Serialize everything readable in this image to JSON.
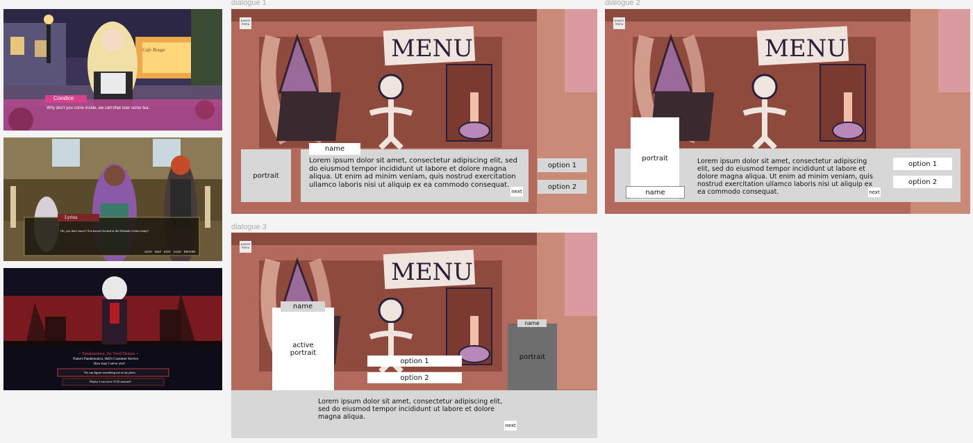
{
  "colors": {
    "canvas": "#f4f4f4",
    "scene_bg": "#b36a5c",
    "panel": "#d7d7d7",
    "dark_portrait": "#6e6e6e",
    "label": "#a9a9a9"
  },
  "references": {
    "ref1": {
      "speaker": "Condice",
      "line": "Why don't you come inside, we can chat over some tea.",
      "sign": "Cafe Rouge"
    },
    "ref2": {
      "speaker": "Lyrina",
      "line": "Oh, you don't know? You haven't looked at the Nalendir Codex today?",
      "menu": [
        "AUTO",
        "SKIP",
        "SAVE",
        "LOAD",
        "HISTORY"
      ]
    },
    "ref3": {
      "title": "⋆ Pandemonica, the Tired Demon ⋆",
      "line1": "Name's Pandemonica, Hell's Customer Service.",
      "line2": "How may I serve you?",
      "choice1": "We can figure something out at my place.",
      "choice2": "Maybe I can serve YOU instead?"
    }
  },
  "frames": {
    "d1": {
      "label": "dialogue 1",
      "pause": [
        "pause/",
        "menu"
      ],
      "sign": "MENU",
      "portrait": "portrait",
      "name": "name",
      "body": "Lorem ipsum dolor sit amet, consectetur adipiscing elit, sed do eiusmod tempor incididunt ut labore et dolore magna aliqua. Ut enim ad minim veniam, quis nostrud exercitation ullamco laboris nisi ut aliquip ex ea commodo consequat.",
      "next": "next",
      "option1": "option 1",
      "option2": "option 2"
    },
    "d2": {
      "label": "dialogue 2",
      "pause": [
        "pause/",
        "menu"
      ],
      "sign": "MENU",
      "portrait": "portrait",
      "name": "name",
      "body": "Lorem ipsum dolor sit amet, consectetur adipiscing elit, sed do eiusmod tempor incididunt ut labore et dolore magna aliqua. Ut enim ad minim veniam, quis nostrud exercitation ullamco laboris nisi ut aliquip ex ea commodo consequat.",
      "next": "next",
      "option1": "option 1",
      "option2": "option 2"
    },
    "d3": {
      "label": "dialogue 3",
      "pause": [
        "pause/",
        "menu"
      ],
      "sign": "MENU",
      "active_portrait": "active portrait",
      "active_name": "name",
      "portrait": "portrait",
      "name": "name",
      "body": "Lorem ipsum dolor sit amet, consectetur adipiscing elit, sed do eiusmod tempor incididunt ut labore et dolore magna aliqua.",
      "next": "next",
      "option1": "option 1",
      "option2": "option 2"
    }
  }
}
